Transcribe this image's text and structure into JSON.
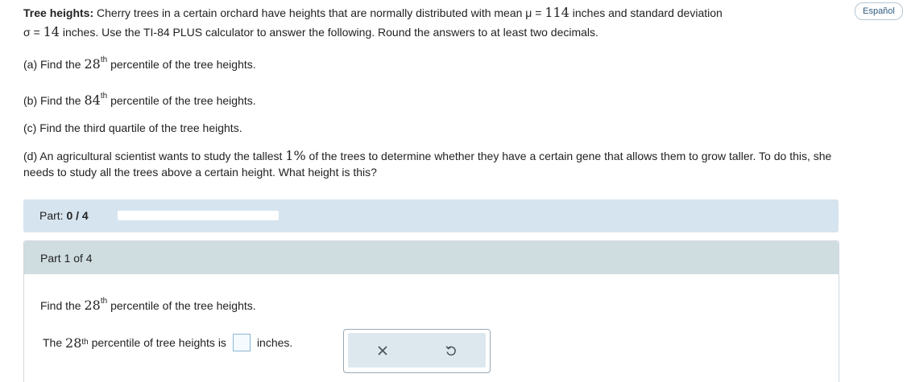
{
  "problem": {
    "title": "Tree heights:",
    "line1_pre": "Cherry trees in a certain orchard have heights that are normally distributed with mean",
    "mu_symbol": "μ",
    "eq": "=",
    "mu_value": "114",
    "line1_post": "inches and standard deviation",
    "sigma_symbol": "σ",
    "sigma_value": "14",
    "line2_post": "inches. Use the TI-84 PLUS calculator to answer the following. Round the answers to at least two decimals."
  },
  "language_button": "Español",
  "questions": {
    "a_prefix": "(a) Find the",
    "a_number": "28",
    "a_suffix": "th",
    "a_rest": "percentile of the tree heights.",
    "b_prefix": "(b) Find the",
    "b_number": "84",
    "b_suffix": "th",
    "b_rest": "percentile of the tree heights.",
    "c_text": "(c) Find the third quartile of the tree heights.",
    "d_pre": "(d) An agricultural scientist wants to study the tallest",
    "d_number": "1%",
    "d_post": "of the trees to determine whether they have a certain gene that allows them to grow taller. To do this, she needs to study all the trees above a certain height. What height is this?"
  },
  "part_progress": {
    "label": "Part:",
    "value": "0 / 4",
    "fraction": 0
  },
  "panel": {
    "header": "Part 1 of 4",
    "question_prefix": "Find the",
    "question_number": "28",
    "question_suffix": "th",
    "question_rest": "percentile of the tree heights.",
    "answer_prefix": "The",
    "answer_number": "28",
    "answer_suffix": "th",
    "answer_rest": "percentile of tree heights is",
    "answer_value": "",
    "answer_unit": "inches."
  },
  "tools": {
    "clear_icon": "x-icon",
    "undo_icon": "undo-icon"
  }
}
